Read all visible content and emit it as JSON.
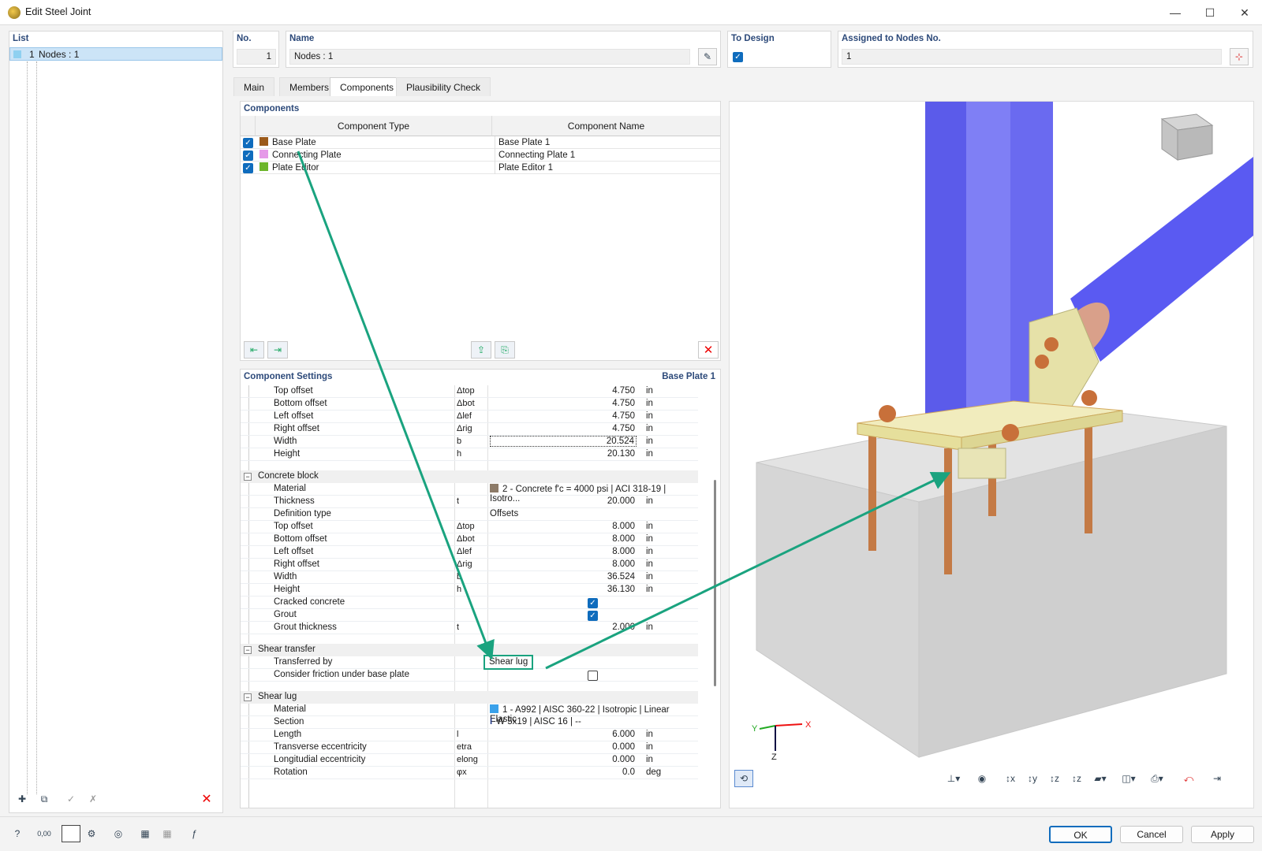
{
  "window": {
    "title": "Edit Steel Joint",
    "minimize": "—",
    "maximize": "☐",
    "close": "✕"
  },
  "list": {
    "label": "List",
    "items": [
      {
        "num": "1",
        "text": "Nodes : 1"
      }
    ]
  },
  "header": {
    "no_label": "No.",
    "no_value": "1",
    "name_label": "Name",
    "name_value": "Nodes : 1",
    "design_label": "To Design",
    "nodes_label": "Assigned to Nodes No.",
    "nodes_value": "1"
  },
  "tabs": [
    "Main",
    "Members",
    "Components",
    "Plausibility Check"
  ],
  "components": {
    "title": "Components",
    "col_type": "Component Type",
    "col_name": "Component Name",
    "rows": [
      {
        "type": "Base Plate",
        "name": "Base Plate 1",
        "color": "#9b5a1a"
      },
      {
        "type": "Connecting Plate",
        "name": "Connecting Plate 1",
        "color": "#e59ae8"
      },
      {
        "type": "Plate Editor",
        "name": "Plate Editor 1",
        "color": "#6cb52b"
      }
    ]
  },
  "settings": {
    "title": "Component Settings",
    "context": "Base Plate 1",
    "plate_rows": [
      {
        "label": "Top offset",
        "sym": "Δtop",
        "value": "4.750",
        "unit": "in"
      },
      {
        "label": "Bottom offset",
        "sym": "Δbot",
        "value": "4.750",
        "unit": "in"
      },
      {
        "label": "Left offset",
        "sym": "Δlef",
        "value": "4.750",
        "unit": "in"
      },
      {
        "label": "Right offset",
        "sym": "Δrig",
        "value": "4.750",
        "unit": "in"
      },
      {
        "label": "Width",
        "sym": "b",
        "value": "20.524",
        "unit": "in"
      },
      {
        "label": "Height",
        "sym": "h",
        "value": "20.130",
        "unit": "in"
      }
    ],
    "concrete": {
      "title": "Concrete block",
      "material_label": "Material",
      "material_value": "2 - Concrete f'c = 4000 psi | ACI 318-19 | Isotro...",
      "rows": [
        {
          "label": "Thickness",
          "sym": "t",
          "value": "20.000",
          "unit": "in"
        },
        {
          "label": "Definition type",
          "sym": "",
          "text": "Offsets"
        },
        {
          "label": "Top offset",
          "sym": "Δtop",
          "value": "8.000",
          "unit": "in"
        },
        {
          "label": "Bottom offset",
          "sym": "Δbot",
          "value": "8.000",
          "unit": "in"
        },
        {
          "label": "Left offset",
          "sym": "Δlef",
          "value": "8.000",
          "unit": "in"
        },
        {
          "label": "Right offset",
          "sym": "Δrig",
          "value": "8.000",
          "unit": "in"
        },
        {
          "label": "Width",
          "sym": "b",
          "value": "36.524",
          "unit": "in"
        },
        {
          "label": "Height",
          "sym": "h",
          "value": "36.130",
          "unit": "in"
        }
      ],
      "cracked_label": "Cracked concrete",
      "grout_label": "Grout",
      "grout_thickness": {
        "label": "Grout thickness",
        "sym": "t",
        "value": "2.000",
        "unit": "in"
      }
    },
    "shear_transfer": {
      "title": "Shear transfer",
      "transferred_label": "Transferred by",
      "transferred_value": "Shear lug",
      "friction_label": "Consider friction under base plate"
    },
    "shear_lug": {
      "title": "Shear lug",
      "material_label": "Material",
      "material_value": "1 - A992 | AISC 360-22 | Isotropic | Linear Elastic",
      "section_label": "Section",
      "section_value": "W 5x19 | AISC 16 | --",
      "rows": [
        {
          "label": "Length",
          "sym": "l",
          "value": "6.000",
          "unit": "in"
        },
        {
          "label": "Transverse eccentricity",
          "sym": "etra",
          "value": "0.000",
          "unit": "in"
        },
        {
          "label": "Longitudial eccentricity",
          "sym": "elong",
          "value": "0.000",
          "unit": "in"
        },
        {
          "label": "Rotation",
          "sym": "φx",
          "value": "0.0",
          "unit": "deg"
        }
      ]
    }
  },
  "viewer": {
    "axis_x": "X",
    "axis_y": "Y",
    "axis_z": "Z"
  },
  "buttons": {
    "ok": "OK",
    "cancel": "Cancel",
    "apply": "Apply"
  },
  "colors": {
    "accent": "#0f6cbd",
    "arrow": "#1aa37f",
    "column": "#6b6bf0",
    "plate": "#ece7b4",
    "bolt": "#c8703a",
    "concrete": "#d9d9d9"
  }
}
